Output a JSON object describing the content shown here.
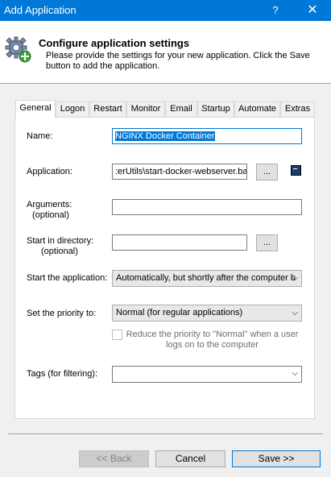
{
  "window": {
    "title": "Add Application",
    "help_glyph": "?",
    "close_glyph": "✕"
  },
  "header": {
    "title": "Configure application settings",
    "description": "Please provide the settings for your new application. Click the Save button to add the application."
  },
  "tabs": [
    {
      "label": "General",
      "active": true
    },
    {
      "label": "Logon"
    },
    {
      "label": "Restart"
    },
    {
      "label": "Monitor"
    },
    {
      "label": "Email"
    },
    {
      "label": "Startup"
    },
    {
      "label": "Automate"
    },
    {
      "label": "Extras"
    }
  ],
  "form": {
    "name_label": "Name:",
    "name_value": "NGINX Docker Container",
    "application_label": "Application:",
    "application_value": ":erUtils\\start-docker-webserver.bat",
    "browse_label": "...",
    "arguments_label": "Arguments:",
    "arguments_hint": "(optional)",
    "arguments_value": "",
    "start_dir_label": "Start in directory:",
    "start_dir_hint": "(optional)",
    "start_dir_value": "",
    "start_app_label": "Start the application:",
    "start_app_value": "Automatically, but shortly after the computer b",
    "priority_label": "Set the priority to:",
    "priority_value": "Normal (for regular applications)",
    "reduce_priority_label": "Reduce the priority to \"Normal\" when a user logs on to the computer",
    "reduce_priority_checked": false,
    "tags_label": "Tags (for filtering):",
    "tags_value": ""
  },
  "footer": {
    "back_label": "<< Back",
    "cancel_label": "Cancel",
    "save_label": "Save >>"
  },
  "icons": {
    "header_icon": "gear-add-icon",
    "terminal_icon": "terminal-icon",
    "dropdown_icon": "chevron-down-icon"
  },
  "colors": {
    "titlebar": "#0078d7",
    "accent": "#0078d7",
    "window_bg": "#f0f0f0"
  }
}
